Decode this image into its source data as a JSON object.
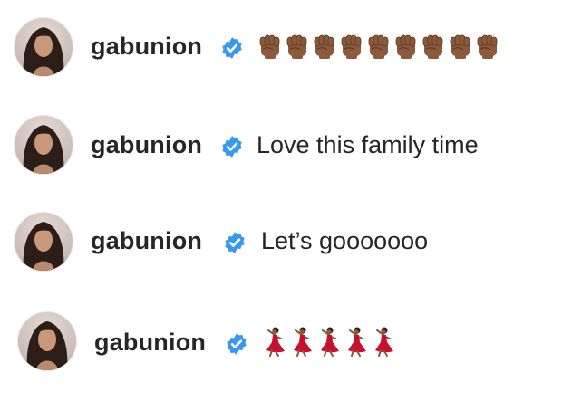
{
  "comments": [
    {
      "username": "gabunion",
      "verified": true,
      "text": "",
      "emoji": "✊🏾",
      "emoji_count": 9
    },
    {
      "username": "gabunion",
      "verified": true,
      "text": "Love this family time"
    },
    {
      "username": "gabunion",
      "verified": true,
      "text": "Let’s gooooooo"
    },
    {
      "username": "gabunion",
      "verified": true,
      "text": "",
      "emoji": "💃🏾",
      "emoji_count": 5
    }
  ],
  "colors": {
    "username": "#262626",
    "text": "#262626",
    "verified_badge": "#3897f0",
    "fist_skin": "#8a5a3a",
    "dancer_dress": "#c8102e"
  },
  "icons": {
    "verified": "verified-badge-icon",
    "avatar": "profile-avatar"
  }
}
